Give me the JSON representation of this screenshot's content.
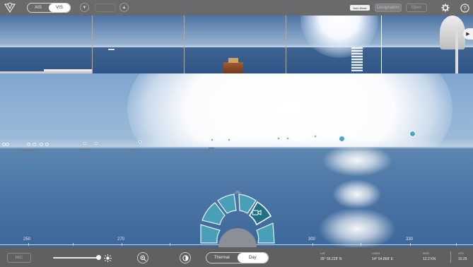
{
  "topbar": {
    "source_toggle": [
      "AIS",
      "VIS"
    ],
    "source_selected": "VIS",
    "disabled_field": "",
    "auto_mode": "Auto Mode",
    "designation": "Designation",
    "open": "Open",
    "icons": [
      "logo-icon",
      "triangle-down-icon",
      "triangle-up-icon",
      "gear-icon",
      "help-icon"
    ]
  },
  "scale": {
    "labels": [
      "250",
      "270",
      "300",
      "330"
    ]
  },
  "dial": {
    "icons": [
      "camera-icon"
    ]
  },
  "bottom": {
    "rec": "REC",
    "mode_options": [
      "Thermal",
      "Day"
    ],
    "mode_selected": "Day",
    "lat_label": "LAT",
    "lat_value": "35° 56.228' N",
    "long_label": "LONG",
    "long_value": "14° 54.868' E",
    "sog_label": "SOG",
    "sog_value": "12.2 KN",
    "utc_label": "UTC",
    "utc_value": "15:25"
  },
  "colors": {
    "accent": "#2b7f99",
    "dial_segment": "#4a9fb8",
    "bar": "#606062"
  }
}
